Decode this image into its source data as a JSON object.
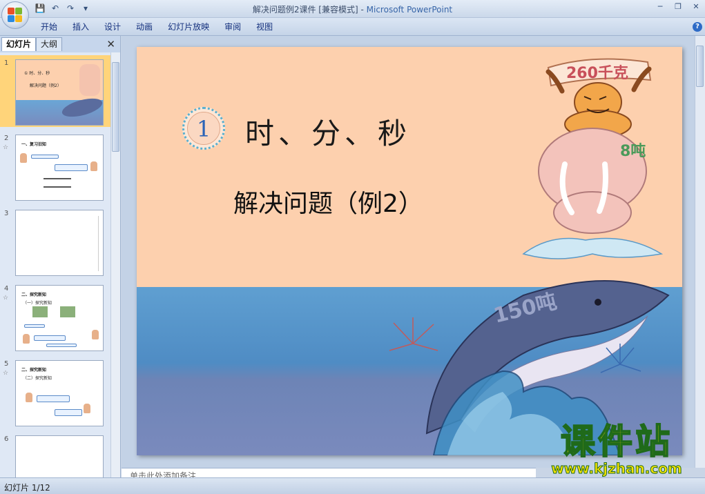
{
  "window": {
    "doc_title": "解决问题例2课件 [兼容模式]",
    "separator": " - ",
    "app_name": "Microsoft PowerPoint"
  },
  "ribbon": {
    "tabs": [
      "开始",
      "插入",
      "设计",
      "动画",
      "幻灯片放映",
      "审阅",
      "视图"
    ]
  },
  "pane": {
    "tab_slides": "幻灯片",
    "tab_outline": "大纲",
    "thumbnails": [
      {
        "num": "1",
        "selected": true,
        "title_line": "① 时、分、秒",
        "subtitle_line": "解决问题（例2）"
      },
      {
        "num": "2",
        "selected": false,
        "title_line": "一、复习旧知"
      },
      {
        "num": "3",
        "selected": false
      },
      {
        "num": "4",
        "selected": false,
        "title_line": "二、探究新知",
        "sub_line": "（一）探究新知"
      },
      {
        "num": "5",
        "selected": false,
        "title_line": "二、探究新知",
        "sub_line": "（二）探究新知"
      },
      {
        "num": "6",
        "selected": false
      }
    ]
  },
  "slide": {
    "badge_number": "1",
    "title": "时、分、秒",
    "subtitle": "解决问题（例2）",
    "tiger_sign": "260千克",
    "elephant_label": "8吨",
    "whale_label": "150吨"
  },
  "notes": {
    "placeholder": "单击此处添加备注"
  },
  "status": {
    "slide_counter": "幻灯片 1/12"
  },
  "watermark": {
    "main": "课件站",
    "url": "www.kjzhan.com"
  },
  "colors": {
    "sky": "#fdd0ae",
    "sea": "#5f9fd1",
    "badge_number": "#2a63b7",
    "watermark_fill": "#f7e300",
    "watermark_stroke": "#1f6a1a",
    "selected_thumb": "#ffd47a"
  }
}
